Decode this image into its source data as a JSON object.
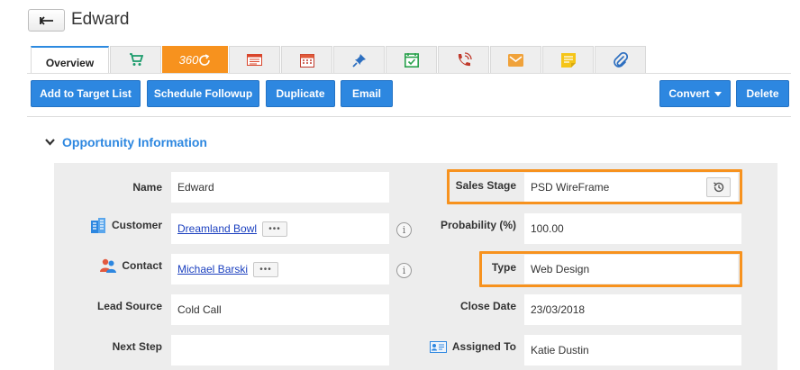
{
  "header": {
    "title": "Edward",
    "back_icon": "arrow-left-icon"
  },
  "tabs": [
    {
      "label": "Overview",
      "active": true
    },
    {
      "icon": "cart-icon"
    },
    {
      "label": "360",
      "icon": "refresh-icon"
    },
    {
      "icon": "list-icon"
    },
    {
      "icon": "calendar-icon"
    },
    {
      "icon": "pin-icon"
    },
    {
      "icon": "check-calendar-icon"
    },
    {
      "icon": "phone-icon"
    },
    {
      "icon": "mail-icon"
    },
    {
      "icon": "note-icon"
    },
    {
      "icon": "paperclip-icon"
    }
  ],
  "actions": {
    "add_to_target": "Add to Target List",
    "schedule_followup": "Schedule Followup",
    "duplicate": "Duplicate",
    "email": "Email",
    "convert": "Convert",
    "delete": "Delete"
  },
  "section": {
    "title": "Opportunity Information"
  },
  "fields": {
    "name": {
      "label": "Name",
      "value": "Edward"
    },
    "customer": {
      "label": "Customer",
      "value": "Dreamland Bowl"
    },
    "contact": {
      "label": "Contact",
      "value": "Michael Barski"
    },
    "lead_source": {
      "label": "Lead Source",
      "value": "Cold Call"
    },
    "next_step": {
      "label": "Next Step",
      "value": ""
    },
    "sales_stage": {
      "label": "Sales Stage",
      "value": "PSD WireFrame"
    },
    "probability": {
      "label": "Probability (%)",
      "value": "100.00"
    },
    "type": {
      "label": "Type",
      "value": "Web Design"
    },
    "close_date": {
      "label": "Close Date",
      "value": "23/03/2018"
    },
    "assigned_to": {
      "label": "Assigned To",
      "value": "Katie Dustin"
    }
  },
  "dots_label": "•••",
  "info_label": "i",
  "colors": {
    "accent": "#2d87e0",
    "highlight": "#f7921e",
    "panel": "#ededed"
  }
}
